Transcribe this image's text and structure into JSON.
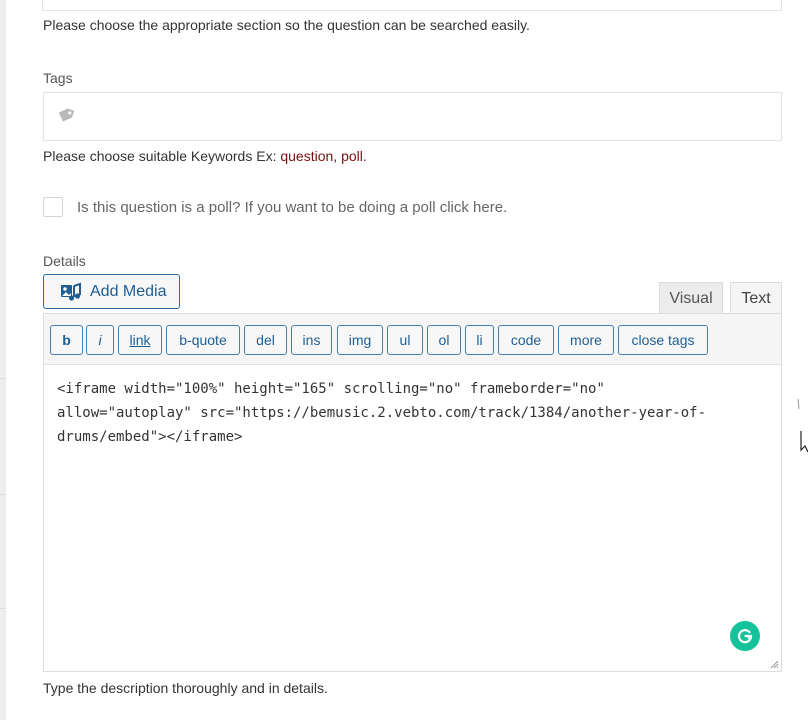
{
  "section_help": "Please choose the appropriate section so the question can be searched easily.",
  "tags": {
    "label": "Tags",
    "icon": "tag-icon",
    "help_prefix": "Please choose suitable Keywords Ex: ",
    "help_keyword1": "question",
    "help_separator": ", ",
    "help_keyword2": "poll",
    "help_suffix": "."
  },
  "poll": {
    "checked": false,
    "label": "Is this question is a poll? If you want to be doing a poll click here."
  },
  "details": {
    "label": "Details",
    "add_media_label": "Add Media",
    "tabs": {
      "visual": "Visual",
      "text": "Text"
    },
    "toolbar": [
      "b",
      "i",
      "link",
      "b-quote",
      "del",
      "ins",
      "img",
      "ul",
      "ol",
      "li",
      "code",
      "more",
      "close tags"
    ],
    "content_lines": [
      "<iframe width=\"100%\" height=\"165\" scrolling=\"no\" frameborder=\"no\"",
      "allow=\"autoplay\" src=\"https://bemusic.2.vebto.com/track/1384/another-year-of-",
      "drums/embed\"></iframe>"
    ],
    "help": "Type the description thoroughly and in details."
  },
  "colors": {
    "link_blue": "#1f5e93",
    "keyword_red": "#7a1010",
    "grammarly_green": "#15c39a"
  }
}
